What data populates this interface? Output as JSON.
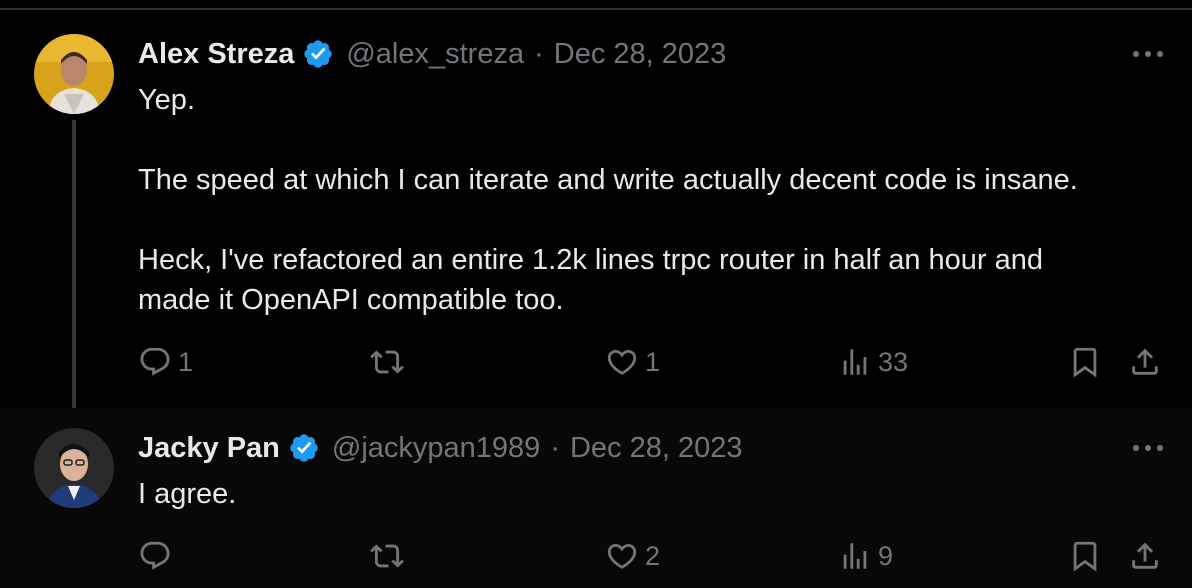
{
  "tweets": [
    {
      "author": {
        "name": "Alex Streza",
        "handle": "@alex_streza",
        "verified": true,
        "avatar_icon": "avatar-photo"
      },
      "separator": "·",
      "date": "Dec 28, 2023",
      "text": {
        "line1": "Yep.",
        "line2": "The speed at which I can iterate and write actually decent code is insane.",
        "line3": "Heck, I've refactored an entire 1.2k lines trpc router in half an hour and",
        "line4": "made it OpenAPI compatible too."
      },
      "actions": {
        "reply_count": "1",
        "retweet_count": "",
        "like_count": "1",
        "views_count": "33"
      }
    },
    {
      "author": {
        "name": "Jacky Pan",
        "handle": "@jackypan1989",
        "verified": true,
        "avatar_icon": "avatar-photo"
      },
      "separator": "·",
      "date": "Dec 28, 2023",
      "text": {
        "line1": "I agree."
      },
      "actions": {
        "reply_count": "",
        "retweet_count": "",
        "like_count": "2",
        "views_count": "9"
      }
    }
  ],
  "colors": {
    "background": "#000000",
    "text": "#e7e9ea",
    "muted": "#71767b",
    "verified": "#1d9bf0",
    "border": "#2f3336"
  },
  "icons": [
    "reply-icon",
    "retweet-icon",
    "like-icon",
    "views-icon",
    "bookmark-icon",
    "share-icon",
    "more-icon",
    "verified-badge-icon"
  ]
}
